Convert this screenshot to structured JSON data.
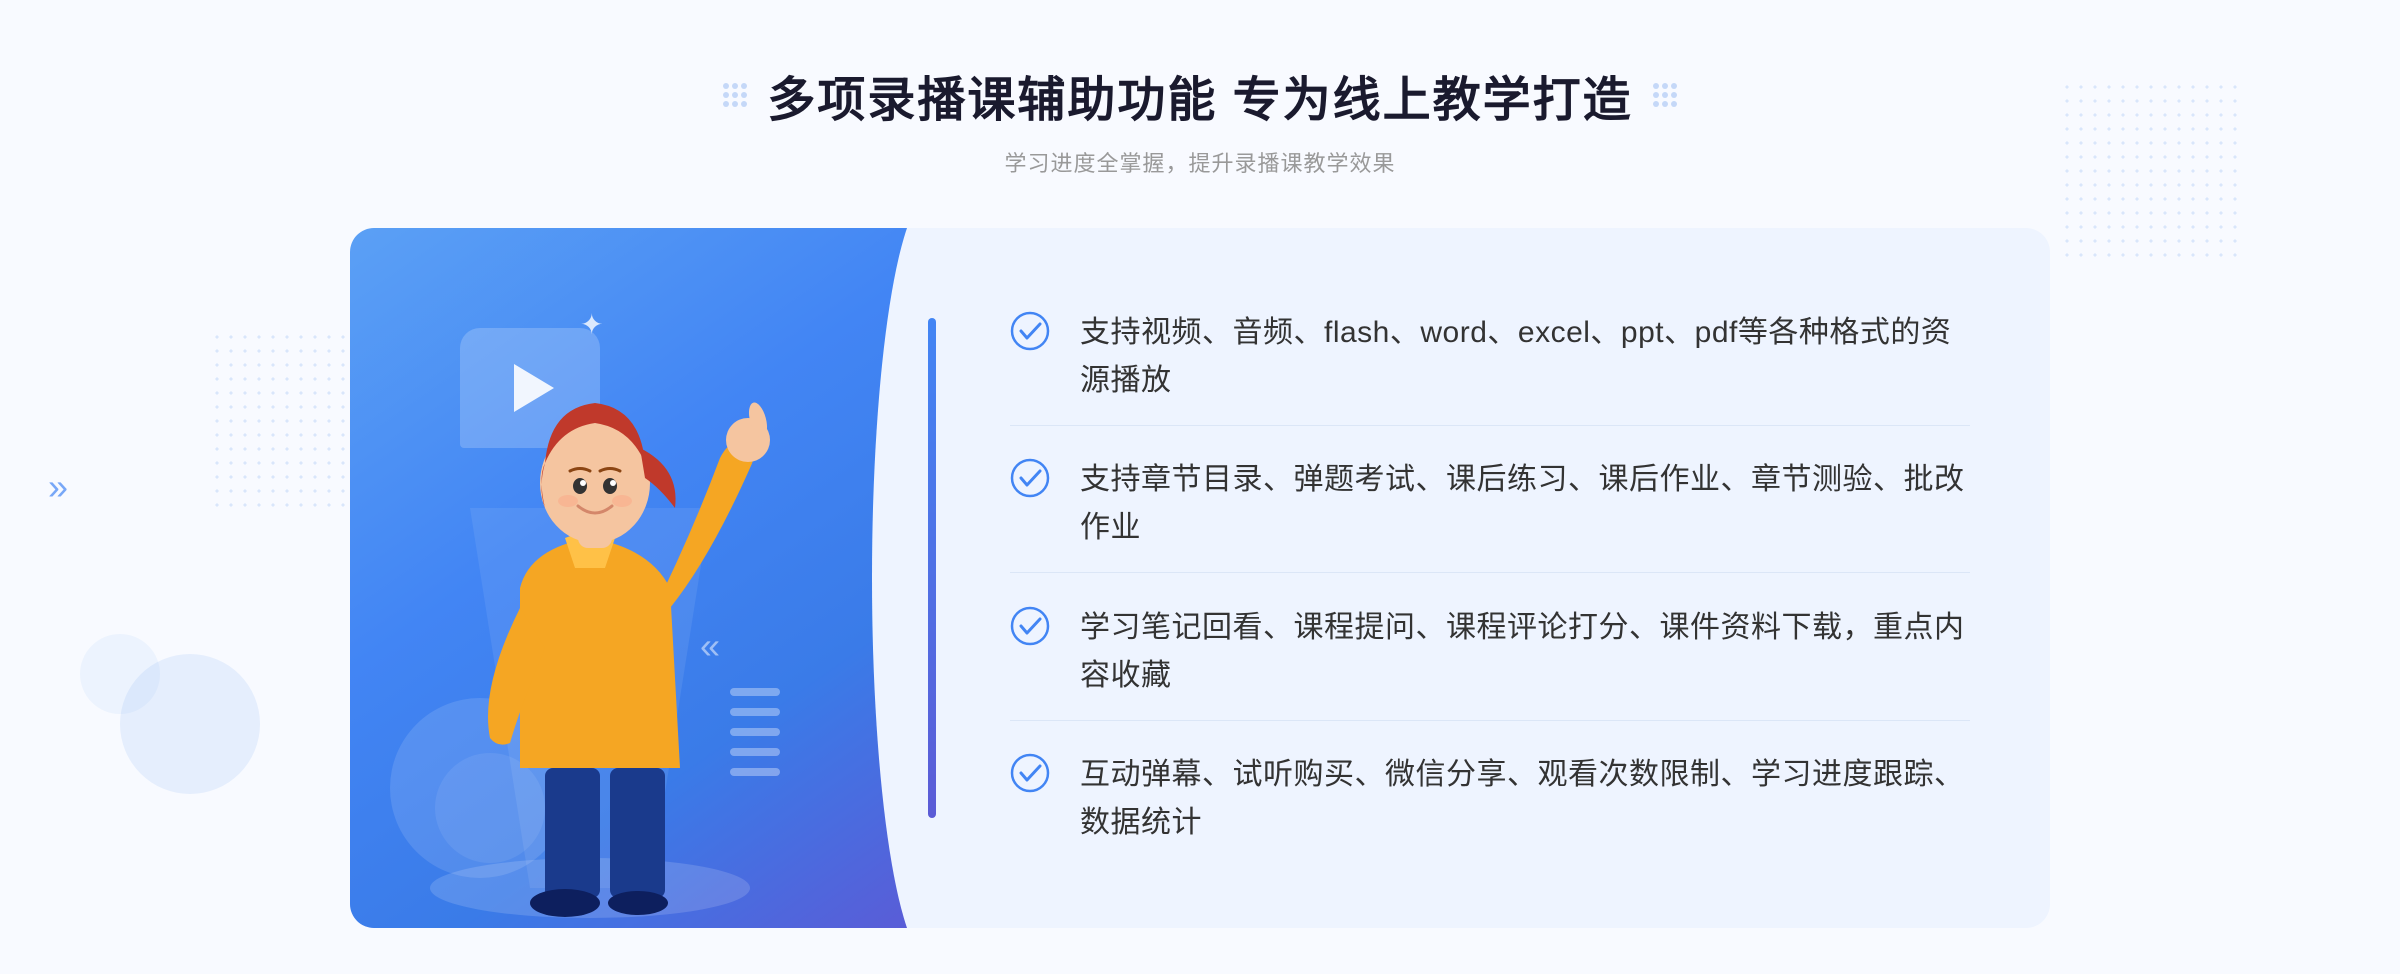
{
  "page": {
    "background_color": "#f8faff"
  },
  "header": {
    "title": "多项录播课辅助功能 专为线上教学打造",
    "subtitle": "学习进度全掌握，提升录播课教学效果",
    "decorative_dots_left": "decorative-grid-icon",
    "decorative_dots_right": "decorative-grid-icon"
  },
  "features": [
    {
      "id": 1,
      "text": "支持视频、音频、flash、word、excel、ppt、pdf等各种格式的资源播放",
      "icon": "check-circle-icon"
    },
    {
      "id": 2,
      "text": "支持章节目录、弹题考试、课后练习、课后作业、章节测验、批改作业",
      "icon": "check-circle-icon"
    },
    {
      "id": 3,
      "text": "学习笔记回看、课程提问、课程评论打分、课件资料下载，重点内容收藏",
      "icon": "check-circle-icon"
    },
    {
      "id": 4,
      "text": "互动弹幕、试听购买、微信分享、观看次数限制、学习进度跟踪、数据统计",
      "icon": "check-circle-icon"
    }
  ],
  "illustration": {
    "play_button_label": "play-button",
    "left_arrow_label": "»"
  },
  "colors": {
    "primary_blue": "#4285f4",
    "light_bg": "#eef4ff",
    "check_color": "#4285f4",
    "text_dark": "#333333",
    "text_light": "#999999"
  }
}
